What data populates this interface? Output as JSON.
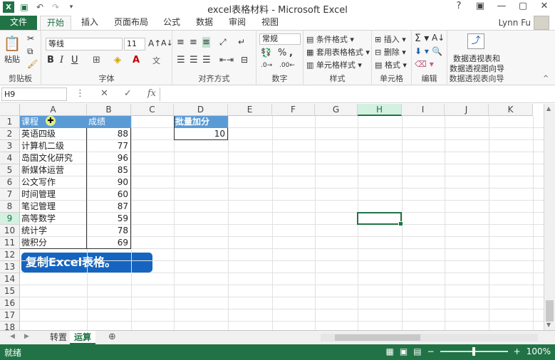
{
  "window": {
    "title": "excel表格材料 - Microsoft Excel",
    "controls": [
      "?",
      "▣",
      "—",
      "▢",
      "✕"
    ]
  },
  "tabs": [
    "文件",
    "开始",
    "插入",
    "页面布局",
    "公式",
    "数据",
    "审阅",
    "视图"
  ],
  "active_tab": "开始",
  "user": {
    "name": "Lynn Fu"
  },
  "ribbon": {
    "clipboard": {
      "paste": "粘贴",
      "label": "剪贴板"
    },
    "font": {
      "name": "等线",
      "size": "11",
      "label": "字体"
    },
    "alignment": {
      "label": "对齐方式"
    },
    "number": {
      "format": "常规",
      "label": "数字"
    },
    "styles": {
      "cond": "条件格式",
      "table": "套用表格格式",
      "cell": "单元格样式",
      "label": "样式"
    },
    "cells": {
      "insert": "插入",
      "delete": "删除",
      "format": "格式",
      "label": "单元格"
    },
    "editing": {
      "label": "编辑"
    },
    "pivot": {
      "line1": "数据透视表和",
      "line2": "数据透视图向导",
      "label": "数据透视表向导"
    }
  },
  "formula_bar": {
    "name_box": "H9",
    "fx": "fx"
  },
  "grid": {
    "columns": [
      "A",
      "B",
      "C",
      "D",
      "E",
      "F",
      "G",
      "H",
      "I",
      "J",
      "K"
    ],
    "rows": [
      "1",
      "2",
      "3",
      "4",
      "5",
      "6",
      "7",
      "8",
      "9",
      "10",
      "11",
      "12",
      "13",
      "14",
      "15",
      "16",
      "17",
      "18"
    ],
    "selected_col": "H",
    "selected_row": "9",
    "header": {
      "course": "课程",
      "score": "成绩",
      "batch": "批量加分"
    },
    "batch_value": "10",
    "courses": [
      "英语四级",
      "计算机二级",
      "岛国文化研究",
      "新媒体运营",
      "公文写作",
      "时间管理",
      "笔记管理",
      "高等数学",
      "统计学",
      "微积分"
    ],
    "scores": [
      "88",
      "77",
      "96",
      "85",
      "90",
      "60",
      "87",
      "59",
      "78",
      "69"
    ]
  },
  "callout": "复制Excel表格。",
  "sheets": [
    "转置",
    "运算"
  ],
  "active_sheet": "运算",
  "status": {
    "ready": "就绪",
    "zoom": "100%"
  }
}
